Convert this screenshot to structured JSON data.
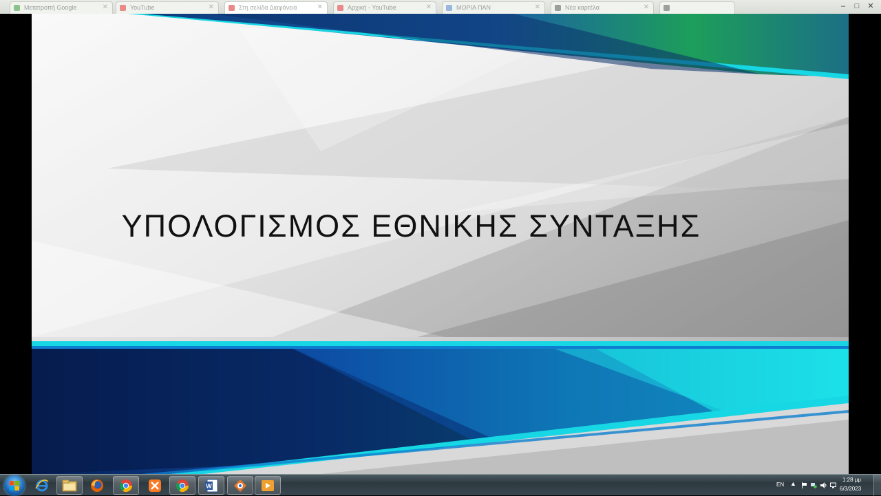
{
  "browser": {
    "tabs": [
      {
        "label": "Μετατροπή Google",
        "fav_color": "#8bc48a"
      },
      {
        "label": "YouTube",
        "fav_color": "#e88a8a"
      },
      {
        "label": "Στη σελίδα Διαφάνεια",
        "fav_color": "#e88a8a"
      },
      {
        "label": "Αρχική - YouTube",
        "fav_color": "#e88a8a"
      },
      {
        "label": "ΜΟΡΙΑ ΠΑΝ",
        "fav_color": "#9ab7e0"
      },
      {
        "label": "Νέα καρτέλα",
        "fav_color": "#9aa19a"
      },
      {
        "label": "",
        "fav_color": "#9aa19a"
      }
    ],
    "window_controls": {
      "minimize": "–",
      "maximize": "□",
      "close": "✕"
    }
  },
  "slide": {
    "title": "ΥΠΟΛΟΓΙΣΜΟΣ ΕΘΝΙΚΗΣ ΣΥΝΤΑΞΗΣ",
    "colors": {
      "cyan": "#16d7e3",
      "blue": "#1b6fd0",
      "navy": "#0a2a66",
      "green": "#1fae56"
    }
  },
  "taskbar": {
    "apps": [
      {
        "name": "internet-explorer-icon"
      },
      {
        "name": "file-explorer-icon"
      },
      {
        "name": "firefox-icon"
      },
      {
        "name": "chrome-icon"
      },
      {
        "name": "xampp-icon"
      },
      {
        "name": "chrome-icon-2"
      },
      {
        "name": "word-icon"
      },
      {
        "name": "presenter-icon"
      },
      {
        "name": "media-player-icon"
      }
    ],
    "tray": {
      "language": "EN",
      "time": "1:28 μμ",
      "date": "6/3/2023"
    }
  }
}
